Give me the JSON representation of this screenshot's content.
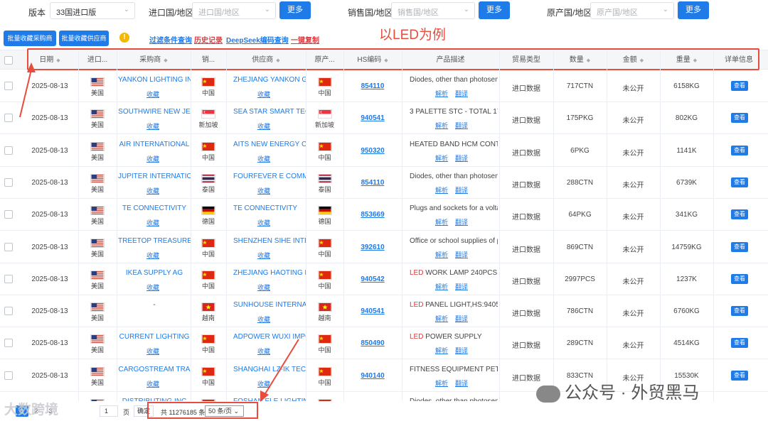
{
  "filters": {
    "version_label": "版本",
    "version_value": "33国进口版",
    "import_label": "进口国/地区",
    "import_placeholder": "进口国/地区",
    "sale_label": "销售国/地区",
    "sale_placeholder": "销售国/地区",
    "origin_label": "原产国/地区",
    "origin_placeholder": "原产国/地区",
    "more_label": "更多"
  },
  "toolbar": {
    "bulk_buyer": "批量收藏采购商",
    "bulk_supplier": "批量收藏供应商",
    "filter_query": "过滤条件查询",
    "history": "历史记录",
    "deepseek": "DeepSeek编码查询",
    "copy": "一键复制",
    "annotation": "以LED为例"
  },
  "table": {
    "headers": {
      "date": "日期",
      "import_country": "进口...",
      "buyer": "采购商",
      "sale_country": "销...",
      "supplier": "供应商",
      "origin": "原产...",
      "hs": "HS编码",
      "desc": "产品描述",
      "trade_type": "贸易类型",
      "qty": "数量",
      "amount": "金额",
      "weight": "重量",
      "detail": "详单信息"
    },
    "collect": "收藏",
    "analyze": "解析",
    "translate": "翻译",
    "view": "查看",
    "rows": [
      {
        "date": "2025-08-13",
        "imp": "美国",
        "buyer": "YANKON LIGHTING IN",
        "sale": "中国",
        "supplier": "ZHEJIANG YANKON GI",
        "origin": "中国",
        "hs": "854110",
        "desc_pre": "",
        "desc": "Diodes, other than photosensi",
        "type": "进口数据",
        "qty": "717CTN",
        "amount": "未公开",
        "weight": "6158KG"
      },
      {
        "date": "2025-08-13",
        "imp": "美国",
        "buyer": "SOUTHWIRE NEW JE",
        "sale": "新加坡",
        "supplier": "SEA STAR SMART TEC",
        "origin": "新加坡",
        "hs": "940541",
        "desc_pre": "",
        "desc": "3 PALETTE STC - TOTAL 175",
        "type": "进口数据",
        "qty": "175PKG",
        "amount": "未公开",
        "weight": "802KG"
      },
      {
        "date": "2025-08-13",
        "imp": "美国",
        "buyer": "AIR INTERNATIONAL",
        "sale": "中国",
        "supplier": "AITS NEW ENERGY C",
        "origin": "中国",
        "hs": "950320",
        "desc_pre": "",
        "desc": "HEATED BAND HCM CONTR",
        "type": "进口数据",
        "qty": "6PKG",
        "amount": "未公开",
        "weight": "1141K"
      },
      {
        "date": "2025-08-13",
        "imp": "美国",
        "buyer": "JUPITER INTERNATIO",
        "sale": "泰国",
        "supplier": "FOURFEVER E COMME",
        "origin": "泰国",
        "hs": "854110",
        "desc_pre": "",
        "desc": "Diodes, other than photosensi",
        "type": "进口数据",
        "qty": "288CTN",
        "amount": "未公开",
        "weight": "6739K"
      },
      {
        "date": "2025-08-13",
        "imp": "美国",
        "buyer": "TE CONNECTIVITY",
        "sale": "德国",
        "supplier": "TE CONNECTIVITY",
        "origin": "德国",
        "hs": "853669",
        "desc_pre": "",
        "desc": "Plugs and sockets for a voltag",
        "type": "进口数据",
        "qty": "64PKG",
        "amount": "未公开",
        "weight": "341KG"
      },
      {
        "date": "2025-08-13",
        "imp": "美国",
        "buyer": "TREETOP TREASURE",
        "sale": "中国",
        "supplier": "SHENZHEN SIHE INTE",
        "origin": "中国",
        "hs": "392610",
        "desc_pre": "",
        "desc": "Office or school supplies of pla",
        "type": "进口数据",
        "qty": "869CTN",
        "amount": "未公开",
        "weight": "14759KG"
      },
      {
        "date": "2025-08-13",
        "imp": "美国",
        "buyer": "IKEA SUPPLY AG",
        "sale": "中国",
        "supplier": "ZHEJIANG HAOTING L",
        "origin": "中国",
        "hs": "940542",
        "desc_pre": "LED",
        "desc": " WORK LAMP 240PCS C",
        "type": "进口数据",
        "qty": "2997PCS",
        "amount": "未公开",
        "weight": "1237K"
      },
      {
        "date": "2025-08-13",
        "imp": "美国",
        "buyer": "-",
        "sale": "越南",
        "supplier": "SUNHOUSE INTERNAT",
        "origin": "越南",
        "hs": "940541",
        "desc_pre": "LED",
        "desc": " PANEL LIGHT,HS:94054",
        "type": "进口数据",
        "qty": "786CTN",
        "amount": "未公开",
        "weight": "6760KG"
      },
      {
        "date": "2025-08-13",
        "imp": "美国",
        "buyer": "CURRENT LIGHTING",
        "sale": "中国",
        "supplier": "ADPOWER WUXI IMPO",
        "origin": "中国",
        "hs": "850490",
        "desc_pre": "LED",
        "desc": " POWER SUPPLY",
        "type": "进口数据",
        "qty": "289CTN",
        "amount": "未公开",
        "weight": "4514KG"
      },
      {
        "date": "2025-08-13",
        "imp": "美国",
        "buyer": "CARGOSTREAM TRA",
        "sale": "中国",
        "supplier": "SHANGHAI LZ-IK TECH",
        "origin": "中国",
        "hs": "940140",
        "desc_pre": "",
        "desc": "FITNESS EQUIPMENT PET C",
        "type": "进口数据",
        "qty": "833CTN",
        "amount": "未公开",
        "weight": "15530K"
      },
      {
        "date": "2025-08-13",
        "imp": "美国",
        "buyer": "DISTRIBUTING INC",
        "sale": "中国",
        "supplier": "FOSHAN ELE LIGHTIN",
        "origin": "中国",
        "hs": "854110",
        "desc_pre": "",
        "desc": "Diodes, other than photosensi",
        "type": "进口数据",
        "qty": "",
        "amount": "",
        "weight": ""
      }
    ]
  },
  "pagination": {
    "pages": [
      "1",
      "2",
      "3"
    ],
    "current": "1",
    "page_unit": "页",
    "go": "确定",
    "total": "共 11276185 条",
    "page_size": "50 条/页"
  },
  "watermarks": {
    "left": "大数跨境",
    "right": "公众号 · 外贸黑马"
  },
  "flags": {
    "美国": "us",
    "中国": "cn",
    "新加坡": "sg",
    "泰国": "th",
    "德国": "de",
    "越南": "vn"
  }
}
